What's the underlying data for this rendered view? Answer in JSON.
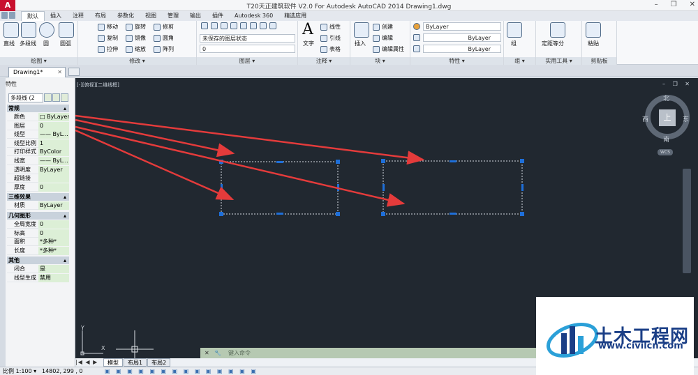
{
  "window": {
    "app_logo": "A",
    "title": "T20天正建筑软件 V2.0 For Autodesk AutoCAD 2014   Drawing1.dwg",
    "controls": [
      "–",
      "❐",
      "✕"
    ]
  },
  "ribbon_tabs": [
    "默认",
    "插入",
    "注释",
    "布局",
    "参数化",
    "视图",
    "管理",
    "输出",
    "插件",
    "Autodesk 360",
    "精选应用"
  ],
  "ribbon": {
    "draw": {
      "label": "绘图 ▾",
      "items": [
        "直线",
        "多段线",
        "圆",
        "圆弧"
      ]
    },
    "modify": {
      "label": "修改 ▾",
      "items": [
        "移动",
        "旋转",
        "修剪",
        "复制",
        "镜像",
        "圆角",
        "拉伸",
        "缩放",
        "阵列"
      ]
    },
    "layers": {
      "label": "图层 ▾",
      "state": "未保存的图层状态",
      "current": "0"
    },
    "annotation": {
      "label": "注释 ▾",
      "text": "文字",
      "linear": "线性",
      "leader": "引线",
      "table": "表格"
    },
    "block": {
      "label": "块 ▾",
      "insert": "插入",
      "create": "创建",
      "edit": "编辑",
      "edit_attr": "编辑属性"
    },
    "properties": {
      "label": "特性 ▾",
      "color": "ByLayer",
      "linetype": "ByLayer",
      "lineweight": "ByLayer"
    },
    "groups": {
      "label": "组 ▾",
      "group": "组"
    },
    "utilities": {
      "label": "实用工具 ▾",
      "measure": "定距等分"
    },
    "clipboard": {
      "label": "剪贴板",
      "paste": "粘贴"
    }
  },
  "doc_tab": {
    "name": "Drawing1*",
    "close": "✕"
  },
  "props_panel": {
    "title": "特性",
    "selector": "多段线 (2",
    "sections": [
      {
        "name": "常规",
        "rows": [
          {
            "k": "颜色",
            "v": "□ ByLayer"
          },
          {
            "k": "图层",
            "v": "0"
          },
          {
            "k": "线型",
            "v": "—— ByL..."
          },
          {
            "k": "线型比例",
            "v": "1"
          },
          {
            "k": "打印样式",
            "v": "ByColor"
          },
          {
            "k": "线宽",
            "v": "—— ByL..."
          },
          {
            "k": "透明度",
            "v": "ByLayer"
          },
          {
            "k": "超链接",
            "v": ""
          },
          {
            "k": "厚度",
            "v": "0"
          }
        ]
      },
      {
        "name": "三维效果",
        "rows": [
          {
            "k": "材质",
            "v": "ByLayer"
          }
        ]
      },
      {
        "name": "几何图形",
        "rows": [
          {
            "k": "全局宽度",
            "v": "0"
          },
          {
            "k": "标高",
            "v": "0"
          },
          {
            "k": "面积",
            "v": "*多种*"
          },
          {
            "k": "长度",
            "v": "*多种*"
          }
        ]
      },
      {
        "name": "其他",
        "rows": [
          {
            "k": "闭合",
            "v": "是"
          },
          {
            "k": "线型生成",
            "v": "禁用"
          }
        ]
      }
    ]
  },
  "viewport": {
    "label": "[-][俯视][二维线框]",
    "compass": {
      "n": "北",
      "s": "南",
      "e": "东",
      "w": "西",
      "center": "上",
      "wcs": "WCS"
    }
  },
  "layout_tabs": [
    "模型",
    "布局1",
    "布局2"
  ],
  "command": {
    "placeholder": "键入命令"
  },
  "status": {
    "coords": "14802, 299 , 0",
    "scale": "比例 1:100 ▾"
  },
  "watermark": {
    "title": "土木工程网",
    "url": "www.civilcn.com"
  },
  "colors": {
    "canvas": "#212830",
    "grip": "#1e6fd9",
    "arrow": "#e43b3b",
    "prop_value_bg": "#dcefd6"
  }
}
